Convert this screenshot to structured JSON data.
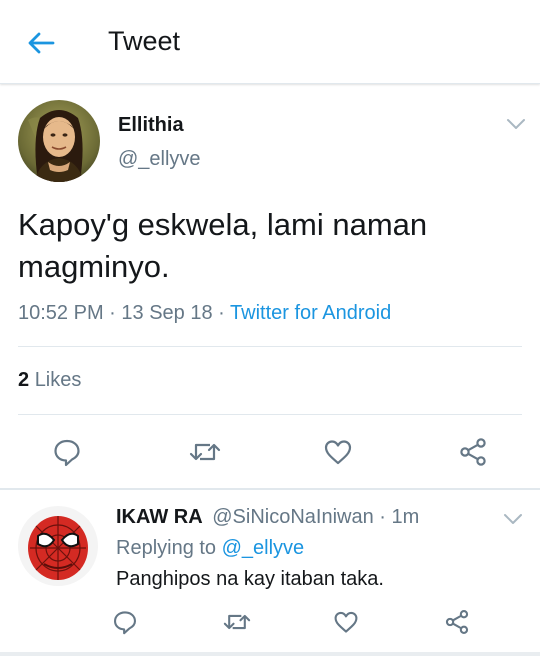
{
  "header": {
    "back_icon": "arrow-left-icon",
    "title": "Tweet"
  },
  "tweet": {
    "author_name": "Ellithia",
    "author_handle": "@_ellyve",
    "text": "Kapoy'g eskwela, lami naman magminyo.",
    "time": "10:52 PM",
    "sep1": " · ",
    "date": "13 Sep 18",
    "sep2": " · ",
    "source": "Twitter for Android",
    "likes_count": "2",
    "likes_label": "Likes"
  },
  "actions": [
    "reply-icon",
    "retweet-icon",
    "like-icon",
    "share-icon"
  ],
  "reply": {
    "name": "IKAW RA",
    "handle": "@SiNicoNaIniwan",
    "sep": " · ",
    "time": "1m",
    "replying_label": "Replying to",
    "replying_to": "@_ellyve",
    "text": "Panghipos na kay itaban taka."
  },
  "colors": {
    "accent": "#1b95e0",
    "secondary_text": "#657786",
    "divider": "#e1e8ed"
  }
}
